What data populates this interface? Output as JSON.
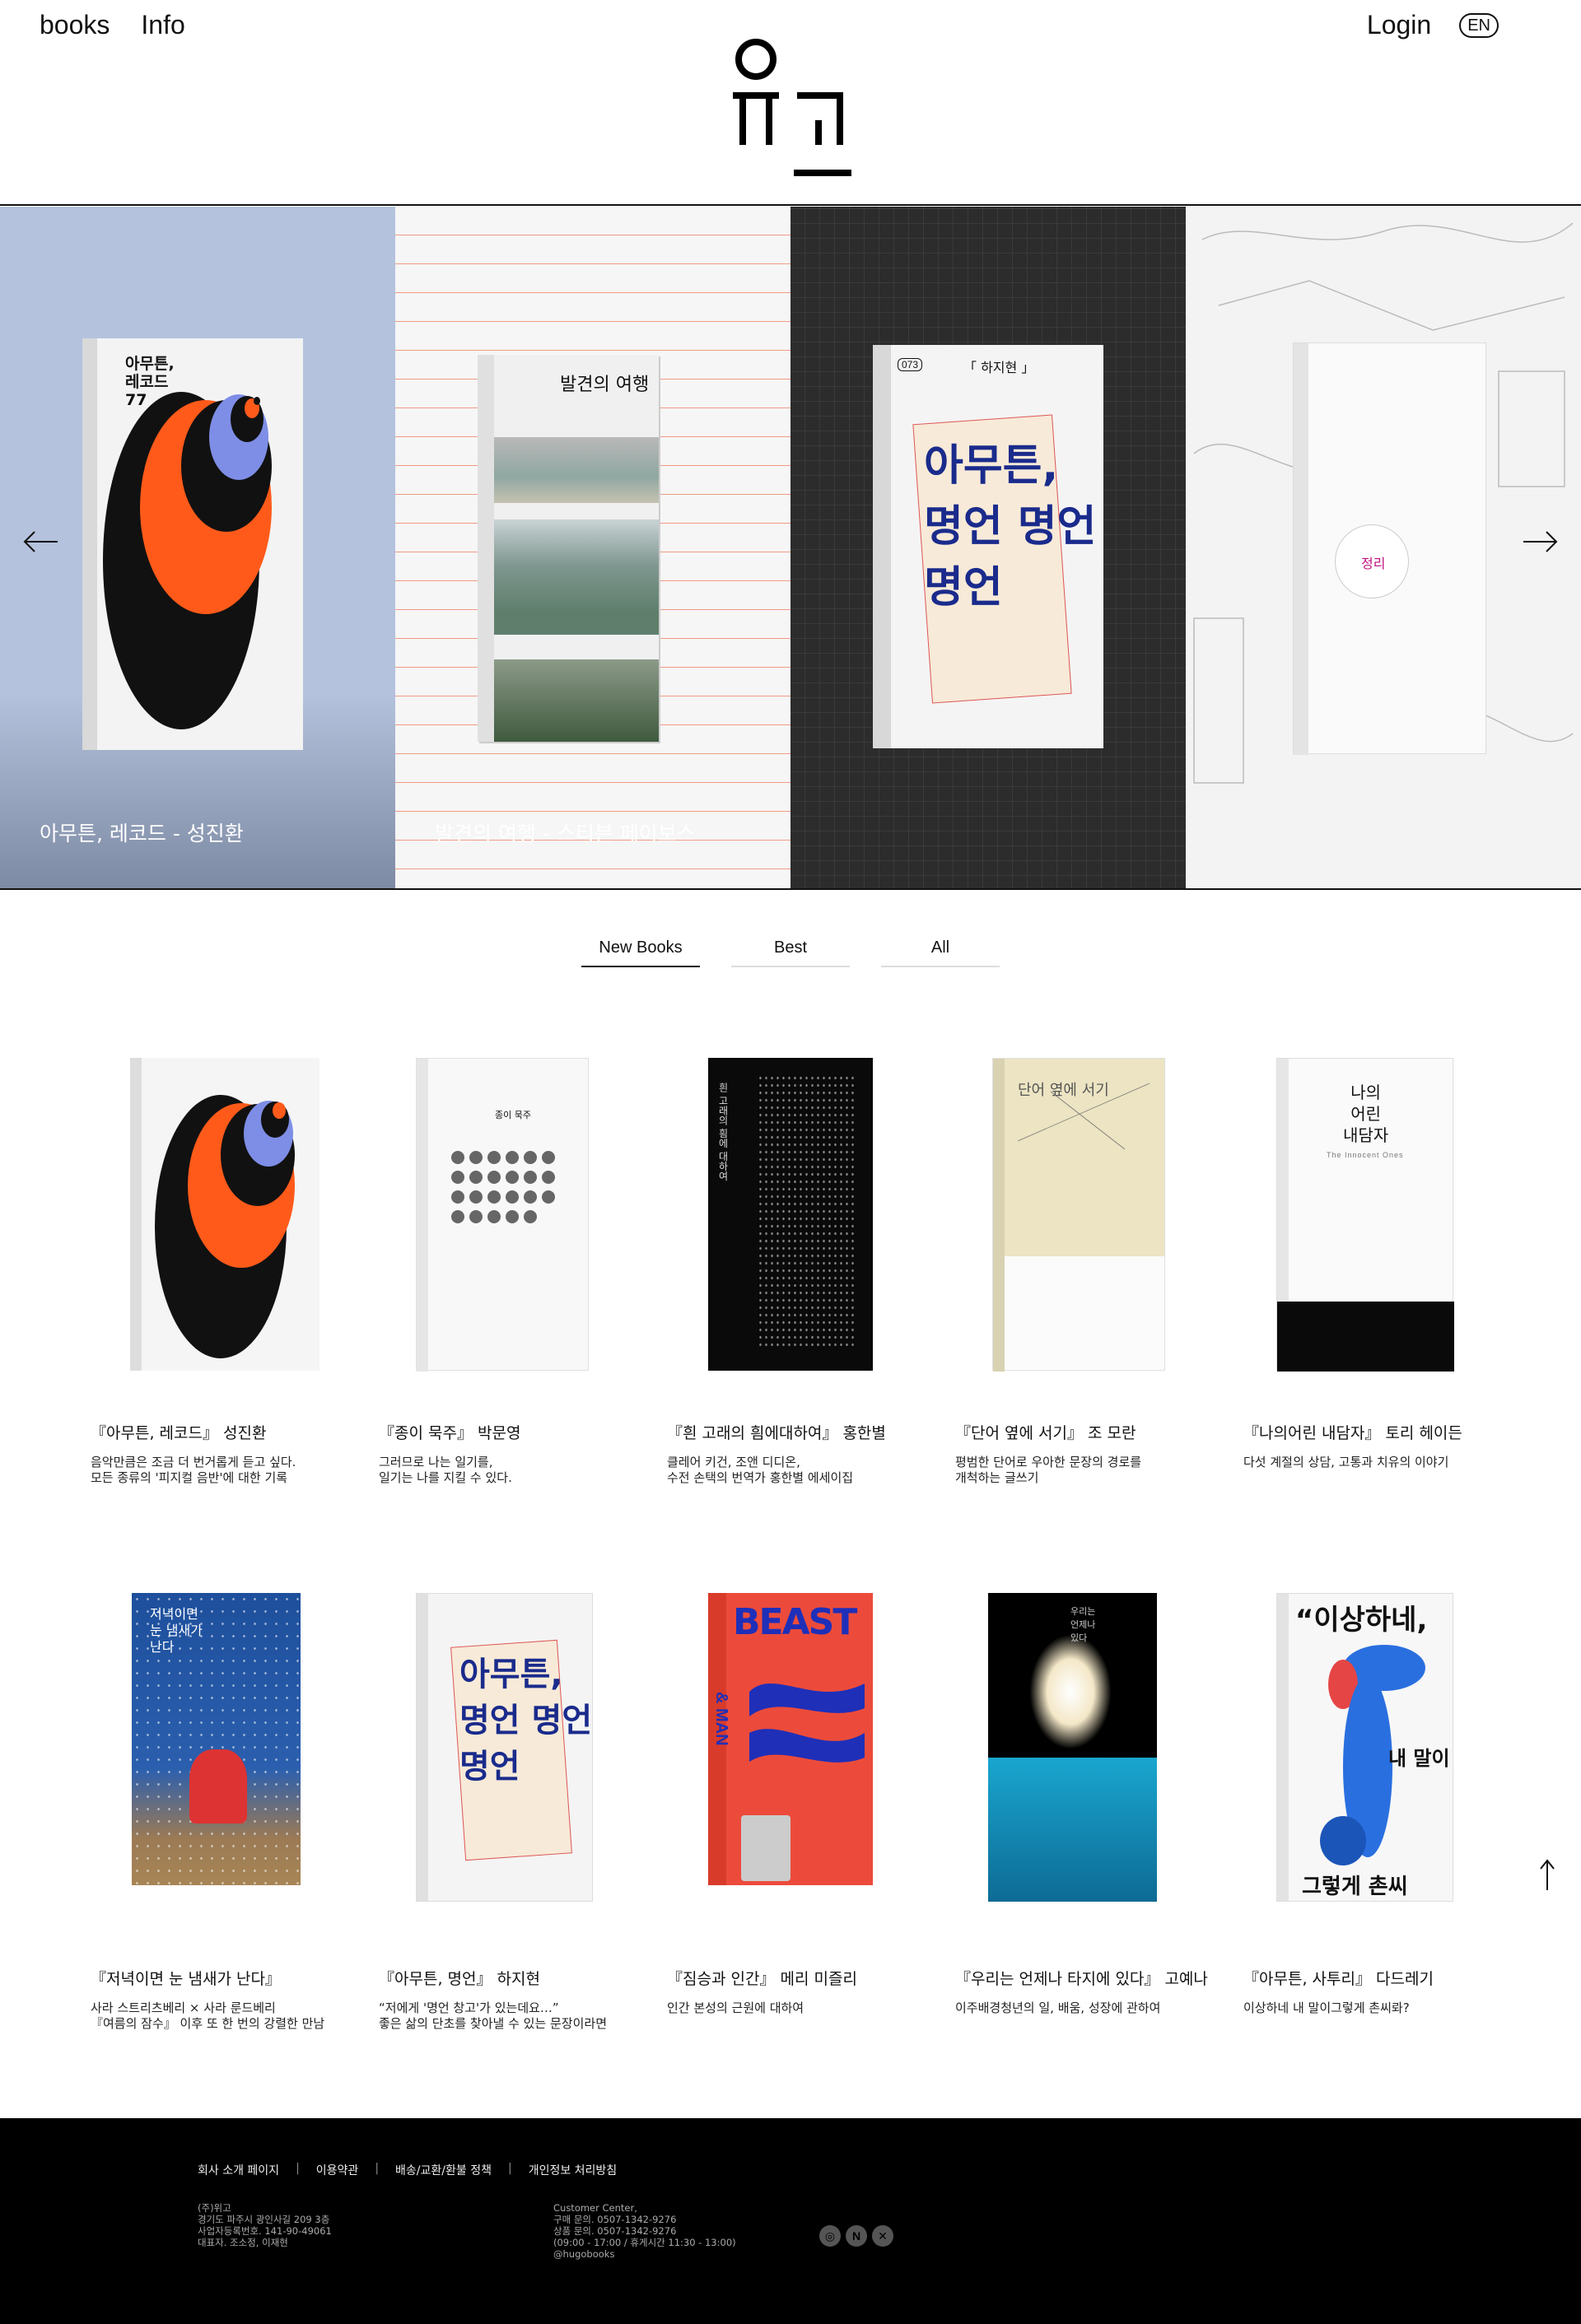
{
  "header": {
    "nav": [
      "books",
      "Info"
    ],
    "login": "Login",
    "lang": "EN",
    "logo_name": "hugo-logo"
  },
  "slider": {
    "slides": [
      {
        "caption": "아무튼, 레코드 - 성진환",
        "bg": "#b4c2dd"
      },
      {
        "caption": "발견의 여행 - 스티븐 페이보스",
        "bg": "#f4f4f4"
      },
      {
        "caption": "",
        "bg": "#2c2c2c"
      },
      {
        "caption": "",
        "bg": "#f2f2f2"
      }
    ],
    "cover_texts": {
      "record_title": "아무튼,\n레코드\n77",
      "discovery_title": "발견의 여행",
      "mongen_author": "「 하지현 」",
      "mongen_tag": "073",
      "mongen_big": "아무튼,\n명언 명언\n명언",
      "cross_label": "정리"
    }
  },
  "tabs": [
    "New Books",
    "Best",
    "All"
  ],
  "books": [
    {
      "title": "『아무튼, 레코드』 성진환",
      "desc": [
        "음악만큼은 조금 더 번거롭게 듣고 싶다.",
        "모든 종류의 '피지컬 음반'에 대한 기록"
      ]
    },
    {
      "title": "『종이 묵주』 박문영",
      "desc": [
        "그러므로 나는 일기를,",
        "일기는 나를 지킬 수 있다."
      ]
    },
    {
      "title": "『흰 고래의 흼에대하여』 홍한별",
      "desc": [
        "클레어 키건, 조앤 디디온,",
        "수전 손택의 번역가 홍한별 에세이집"
      ]
    },
    {
      "title": "『단어 옆에 서기』 조 모란",
      "desc": [
        "평범한 단어로 우아한 문장의 경로를",
        "개척하는 글쓰기"
      ]
    },
    {
      "title": "『나의어린 내담자』 토리 헤이든",
      "desc": [
        "다섯 계절의 상담, 고통과 치유의 이야기"
      ]
    },
    {
      "title": "『저녁이면 눈 냄새가 난다』",
      "desc": [
        "사라 스트리츠베리 × 사라 룬드베리",
        "『여름의 잠수』 이후 또 한 번의 강렬한 만남"
      ]
    },
    {
      "title": "『아무튼, 명언』 하지현",
      "desc": [
        "“저에게 '명언 창고'가 있는데요…”",
        "좋은 삶의 단초를 찾아낼 수 있는 문장이라면"
      ]
    },
    {
      "title": "『짐승과 인간』 메리 미즐리",
      "desc": [
        "인간 본성의 근원에 대하여"
      ]
    },
    {
      "title": "『우리는 언제나 타지에 있다』 고예나",
      "desc": [
        "이주배경청년의 일, 배움, 성장에 관하여"
      ]
    },
    {
      "title": "『아무튼, 사투리』 다드레기",
      "desc": [
        "이상하네 내 말이그렇게 촌씨롸?"
      ]
    }
  ],
  "covers": {
    "paper_rosary": "종이 묵주",
    "white_whale": "흰 고래의 흼에 대하여",
    "beside_word": "단어 옆에 서기",
    "young_client": "나의\n어린\n내담자",
    "young_client_en": "The Innocent Ones",
    "snow_smell": "저녁이면\n눈 냄새가\n난다",
    "beast": "BEAST",
    "beast_man": "& MAN",
    "always_away": "우리는\n언제나\n있다",
    "dialect_big": "“이상하네,",
    "dialect_big2": "내 말이",
    "dialect_big3": "그렇게 촌씨롸?”"
  },
  "footer": {
    "links": [
      "회사 소개 페이지",
      "이용약관",
      "배송/교환/환불 정책",
      "개인정보 처리방침"
    ],
    "company": [
      "(주)위고",
      "경기도 파주시 광인사길 209 3층",
      "사업자등록번호. 141-90-49061",
      "대표자. 조소정, 이재현"
    ],
    "service": [
      "Customer Center,",
      "구매 문의. 0507-1342-9276",
      "상품 문의. 0507-1342-9276",
      "(09:00 - 17:00 / 휴게시간 11:30 - 13:00)",
      "@hugobooks"
    ],
    "social": [
      "instagram-icon",
      "naver-icon",
      "x-icon"
    ]
  }
}
